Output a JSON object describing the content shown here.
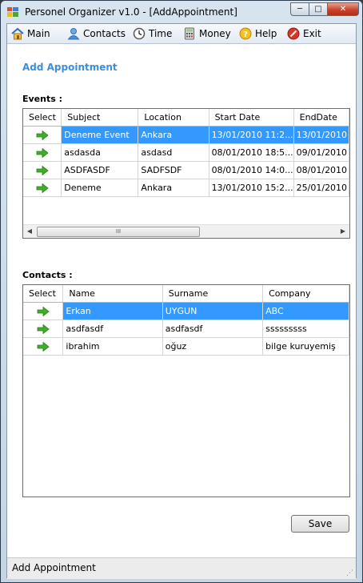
{
  "window": {
    "title": "Personel Organizer v1.0 - [AddAppointment]"
  },
  "window_controls": {
    "minimize": "─",
    "maximize": "□",
    "close": "✕"
  },
  "menu": [
    {
      "label": "Main",
      "icon": "home-icon"
    },
    {
      "label": "Contacts",
      "icon": "user-icon"
    },
    {
      "label": "Time",
      "icon": "clock-icon"
    },
    {
      "label": "Money",
      "icon": "calculator-icon"
    },
    {
      "label": "Help",
      "icon": "help-icon"
    },
    {
      "label": "Exit",
      "icon": "exit-icon"
    }
  ],
  "page": {
    "title": "Add Appointment"
  },
  "events": {
    "label": "Events :",
    "columns": [
      "Select",
      "Subject",
      "Location",
      "Start Date",
      "EndDate"
    ],
    "rows": [
      {
        "subject": "Deneme Event",
        "location": "Ankara",
        "start": "13/01/2010 11:2...",
        "end": "13/01/2010",
        "selected": true
      },
      {
        "subject": "asdasda",
        "location": "asdasd",
        "start": "08/01/2010 18:5...",
        "end": "09/01/2010",
        "selected": false
      },
      {
        "subject": "ASDFASDF",
        "location": "SADFSDF",
        "start": "08/01/2010 14:0...",
        "end": "08/01/2010",
        "selected": false
      },
      {
        "subject": "Deneme",
        "location": "Ankara",
        "start": "13/01/2010 15:2...",
        "end": "25/01/2010",
        "selected": false
      }
    ],
    "scroll_grip": "III"
  },
  "contacts": {
    "label": "Contacts :",
    "columns": [
      "Select",
      "Name",
      "Surname",
      "Company"
    ],
    "rows": [
      {
        "name": "Erkan",
        "surname": "UYGUN",
        "company": "ABC",
        "selected": true
      },
      {
        "name": "asdfasdf",
        "surname": "asdfasdf",
        "company": "sssssssss",
        "selected": false
      },
      {
        "name": "ibrahim",
        "surname": "oğuz",
        "company": "bilge kuruyemiş",
        "selected": false
      }
    ]
  },
  "buttons": {
    "save": "Save"
  },
  "status": {
    "text": "Add Appointment"
  },
  "colors": {
    "accent": "#3c8ed8",
    "selection": "#3399ff",
    "arrow": "#3fae2a"
  }
}
